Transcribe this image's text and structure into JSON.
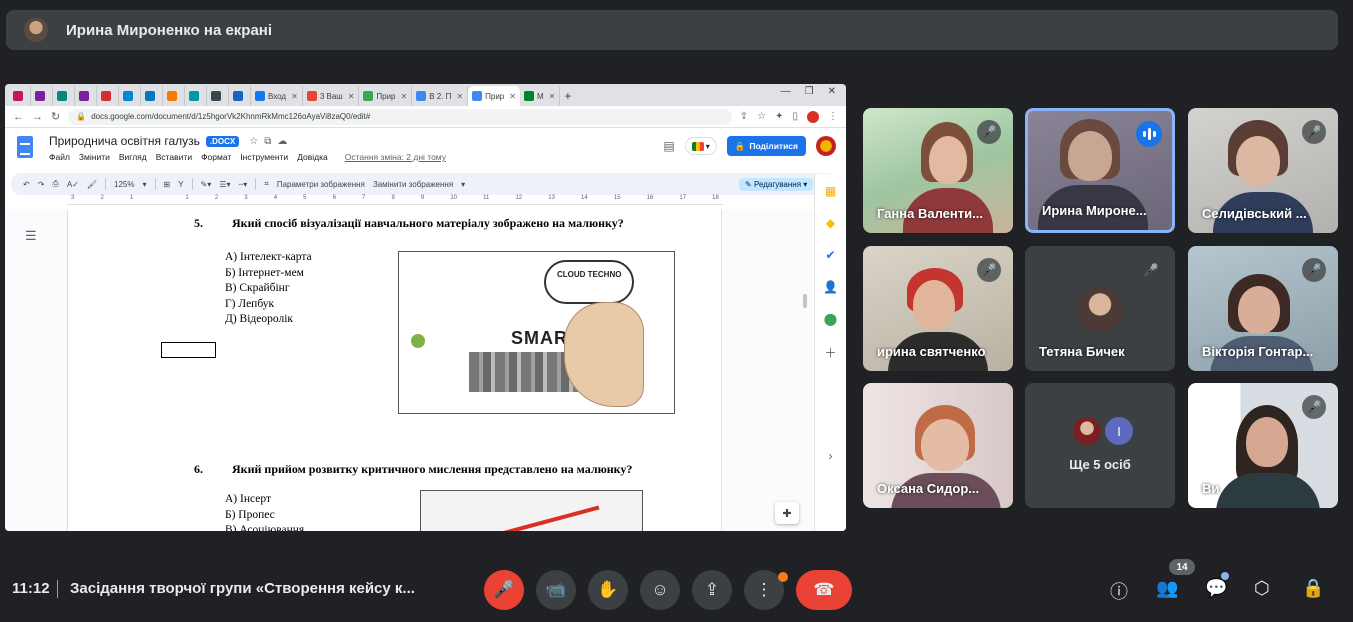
{
  "presenter": {
    "text": "Ирина Мироненко на екрані"
  },
  "browser": {
    "tabs": [
      {
        "label": "",
        "color": "#c2185b"
      },
      {
        "label": "",
        "color": "#7b1fa2"
      },
      {
        "label": "",
        "color": "#00897b"
      },
      {
        "label": "",
        "color": "#7b1fa2"
      },
      {
        "label": "",
        "color": "#d32f2f"
      },
      {
        "label": "",
        "color": "#0288d1"
      },
      {
        "label": "",
        "color": "#0277bd"
      },
      {
        "label": "",
        "color": "#f57c00"
      },
      {
        "label": "",
        "color": "#0097a7"
      },
      {
        "label": "",
        "color": "#37474f"
      },
      {
        "label": "",
        "color": "#1565c0"
      },
      {
        "label": "Вход",
        "color": "#1877f2"
      },
      {
        "label": "3 Ваш",
        "color": "#ea4335"
      },
      {
        "label": "Прир",
        "color": "#34a853"
      },
      {
        "label": "В 2. П",
        "color": "#4285f4"
      },
      {
        "label": "Прир",
        "color": "#4285f4"
      },
      {
        "label": "М",
        "color": "#00832d"
      }
    ],
    "url": "docs.google.com/document/d/1z5hgorVk2KhnmRkMmc126oAyaVi8zaQ0/edit#"
  },
  "docs": {
    "title": "Природнича освітня галузь",
    "badge": ".DOCX",
    "menu": [
      "Файл",
      "Змінити",
      "Вигляд",
      "Вставити",
      "Формат",
      "Інструменти",
      "Довідка"
    ],
    "last_edit": "Остання зміна: 2 дні тому",
    "share": "Поділитися",
    "toolbar": {
      "zoom": "125%",
      "image_options": "Параметри зображення",
      "replace_image": "Замінити зображення",
      "mode": "Редагування"
    },
    "ruler": [
      "3",
      "2",
      "1",
      "",
      "1",
      "2",
      "3",
      "4",
      "5",
      "6",
      "7",
      "8",
      "9",
      "10",
      "11",
      "12",
      "13",
      "14",
      "15",
      "16",
      "17",
      "18"
    ]
  },
  "doc_content": {
    "q5": {
      "num": "5.",
      "text": "Який спосіб візуалізації навчального матеріалу зображено на малюнку?",
      "options": [
        "А) Інтелект-карта",
        "Б) Інтернет-мем",
        "В) Скрайбінг",
        "Г) Лепбук",
        "Д) Відеоролік"
      ],
      "image_text": "SMART",
      "cloud_text": "CLOUD TECHNO"
    },
    "q6": {
      "num": "6.",
      "text": "Який прийом розвитку критичного мислення представлено на малюнку?",
      "options": [
        "А) Інсерт",
        "Б) Пропес",
        "В) Асоціювання"
      ]
    }
  },
  "participants": [
    {
      "name": "Ганна Валенти...",
      "muted": true
    },
    {
      "name": "Ирина Мироне...",
      "muted": false,
      "speaking": true
    },
    {
      "name": "Селидівський ...",
      "muted": true
    },
    {
      "name": "ирина святченко",
      "muted": true
    },
    {
      "name": "Тетяна Бичек",
      "muted": true
    },
    {
      "name": "Вікторія Гонтар...",
      "muted": true
    },
    {
      "name": "Оксана Сидор...",
      "muted": false
    },
    {
      "name": "Ще 5 осіб",
      "letter": "І"
    },
    {
      "name": "Ви",
      "muted": true
    }
  ],
  "bottom": {
    "time": "11:12",
    "meeting_title": "Засідання творчої групи «Створення кейсу к...",
    "people_count": "14"
  },
  "colors": {
    "accent": "#8ab4f8",
    "danger": "#ea4335",
    "surface": "#3c4043",
    "background": "#202124"
  }
}
